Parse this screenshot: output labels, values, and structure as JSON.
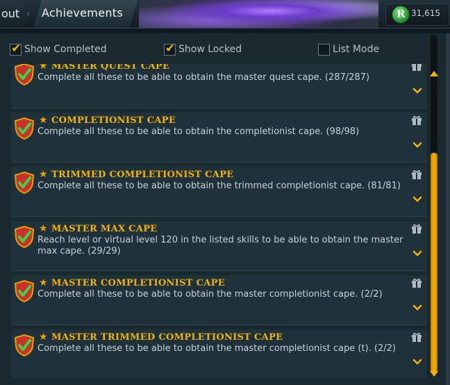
{
  "tabs": {
    "prev_label": "out",
    "active_label": "Achievements"
  },
  "currency": {
    "icon": "runecoin-icon",
    "symbol": "R",
    "value": "31,615"
  },
  "filters": {
    "show_completed": {
      "label": "Show Completed",
      "checked": true
    },
    "show_locked": {
      "label": "Show Locked",
      "checked": true
    },
    "list_mode": {
      "label": "List Mode",
      "checked": false
    }
  },
  "achievements": [
    {
      "title": "MASTER QUEST CAPE",
      "description": "Complete all these to be able to obtain the master quest cape. (287/287)"
    },
    {
      "title": "COMPLETIONIST CAPE",
      "description": "Complete all these to be able to obtain the completionist cape. (98/98)"
    },
    {
      "title": "TRIMMED COMPLETIONIST CAPE",
      "description": "Complete all these to be able to obtain the trimmed completionist cape. (81/81)"
    },
    {
      "title": "MASTER MAX CAPE",
      "description": "Reach level or virtual level 120 in the listed skills to be able to obtain the master max cape. (29/29)"
    },
    {
      "title": "MASTER COMPLETIONIST CAPE",
      "description": "Complete all these to be able to obtain the master completionist cape. (2/2)"
    },
    {
      "title": "MASTER TRIMMED COMPLETIONIST CAPE",
      "description": "Complete all these to be able to obtain the master completionist cape (t). (2/2)"
    }
  ],
  "colors": {
    "accent": "#f4b400",
    "panel": "#1a2830",
    "row": "#1f313b",
    "text": "#c8d2d7"
  }
}
